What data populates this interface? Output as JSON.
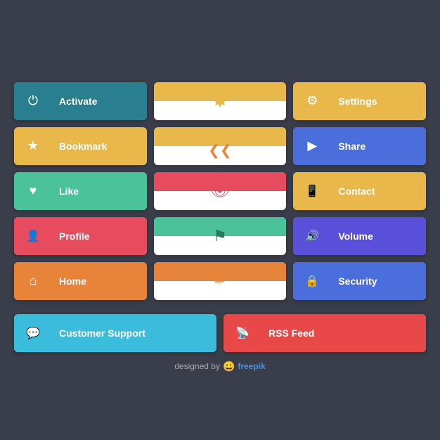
{
  "buttons": {
    "row1": [
      {
        "id": "activate",
        "label": "Activate",
        "icon": "⏻",
        "icon_color": "#2a7f8f",
        "label_color": "#2a7f8f"
      },
      {
        "id": "bookmark_deco",
        "type": "deco",
        "icon": "✦",
        "top_color": "#e8b84b",
        "icon_color": "#e8b84b"
      },
      {
        "id": "settings",
        "label": "Settings",
        "icon": "⚙",
        "icon_color": "#e8b84b",
        "label_color": "#e8b84b"
      }
    ],
    "row2": [
      {
        "id": "bookmark",
        "label": "Bookmark",
        "icon": "★",
        "icon_color": "#e8b84b",
        "label_color": "#e8b84b"
      },
      {
        "id": "share_deco",
        "type": "deco",
        "icon": "❯❯",
        "top_color": "#e8b84b",
        "icon_color": "#e8843a"
      },
      {
        "id": "share",
        "label": "Share",
        "icon": "❯",
        "icon_color": "#4a6fdc",
        "label_color": "#4a6fdc"
      }
    ],
    "row3": [
      {
        "id": "like",
        "label": "Like",
        "icon": "♥",
        "icon_color": "#4ac29a",
        "label_color": "#4ac29a"
      },
      {
        "id": "eye_deco",
        "type": "deco",
        "icon": "👁",
        "top_color": "#e74c5e",
        "icon_color": "#e74c5e"
      },
      {
        "id": "contact",
        "label": "Contact",
        "icon": "📱",
        "icon_color": "#e8b84b",
        "label_color": "#e8b84b"
      }
    ],
    "row4": [
      {
        "id": "profile",
        "label": "Profile",
        "icon": "👤",
        "icon_color": "#e74c5e",
        "label_color": "#e74c5e"
      },
      {
        "id": "flag_deco",
        "type": "deco",
        "icon": "⚑",
        "top_color": "#4ac29a",
        "icon_color": "#3a8a6a"
      },
      {
        "id": "volume",
        "label": "Volume",
        "icon": "🔊",
        "icon_color": "#5a4fd8",
        "label_color": "#5a4fd8"
      }
    ],
    "row5": [
      {
        "id": "home",
        "label": "Home",
        "icon": "⌂",
        "icon_color": "#e8843a",
        "label_color": "#e8843a"
      },
      {
        "id": "pencil_deco",
        "type": "deco",
        "icon": "✏",
        "top_color": "#e8843a",
        "icon_color": "#e8843a"
      },
      {
        "id": "security",
        "label": "Security",
        "icon": "🔒",
        "icon_color": "#4a6fdc",
        "label_color": "#4a6fdc"
      }
    ]
  },
  "wide_buttons": [
    {
      "id": "customer_support",
      "label": "Customer Support",
      "icon": "💬",
      "icon_color": "#3abcdc",
      "label_color": "#3abcdc"
    },
    {
      "id": "rss_feed",
      "label": "RSS Feed",
      "icon": "☰",
      "icon_color": "#e84848",
      "label_color": "#e84848"
    }
  ],
  "footer": {
    "text": "designed by",
    "brand": "freepik"
  }
}
